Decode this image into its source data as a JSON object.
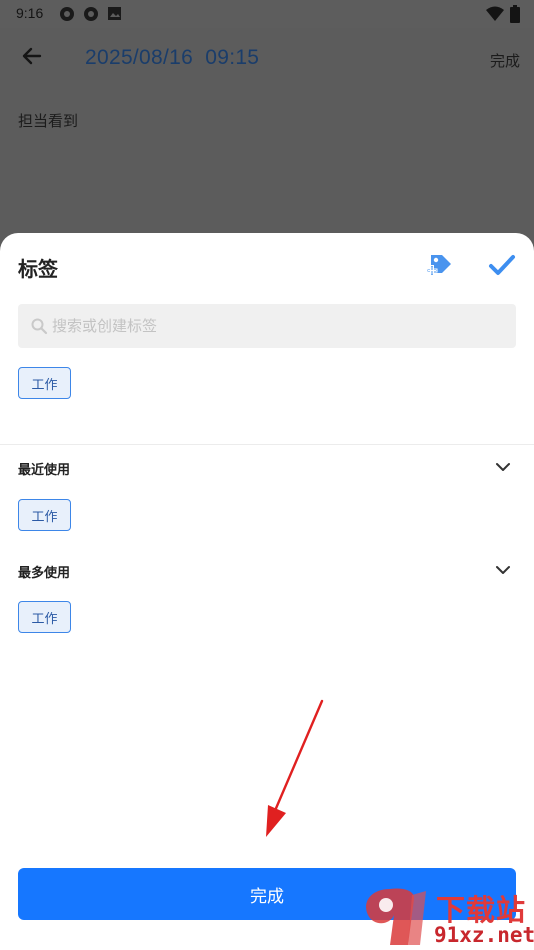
{
  "status_bar": {
    "time": "9:16"
  },
  "header": {
    "datetime": "2025/08/16  09:15",
    "done_label": "完成"
  },
  "note": {
    "text": "担当看到"
  },
  "sheet": {
    "title": "标签",
    "search": {
      "placeholder": "搜索或创建标签",
      "value": ""
    },
    "selected_tags": [
      "工作"
    ],
    "sections": [
      {
        "title": "最近使用",
        "tags": [
          "工作"
        ]
      },
      {
        "title": "最多使用",
        "tags": [
          "工作"
        ]
      }
    ],
    "done_button_label": "完成"
  },
  "colors": {
    "accent": "#1677ff",
    "chip_border": "#3d86e8",
    "chip_bg": "#e8f0fb",
    "annotation_arrow": "#e02020"
  },
  "watermark": {
    "brand": "下载站",
    "url": "91xz.net"
  }
}
